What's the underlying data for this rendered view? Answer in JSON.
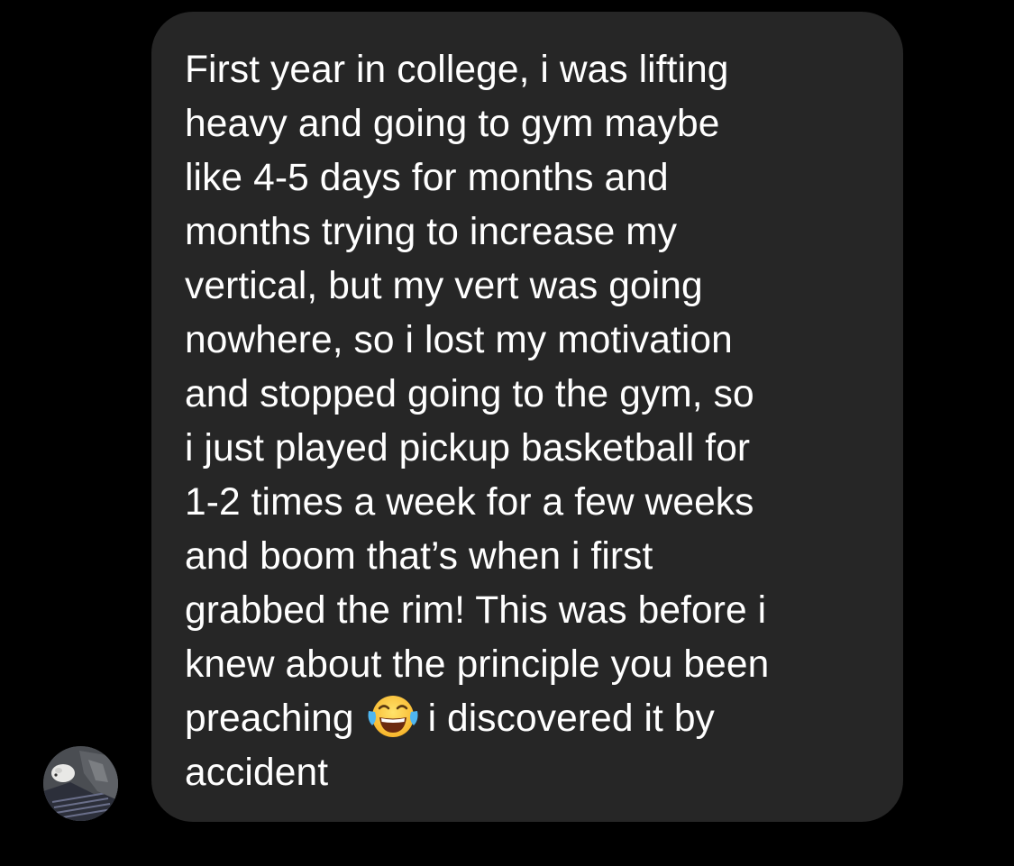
{
  "conversation": {
    "message": {
      "lines": [
        "First year in college, i was lifting",
        "heavy and going to gym maybe",
        "like 4-5 days for months and",
        "months trying to increase my",
        "vertical, but my vert was going",
        "nowhere, so i lost my motivation",
        "and stopped going to the gym, so",
        "i just played pickup basketball for",
        "1-2 times a week for a few weeks",
        "and boom that’s when i first",
        "grabbed the rim! This was before i",
        "knew about the principle you been"
      ],
      "line_13_before_emoji": "preaching",
      "emoji": "face-with-tears-of-joy",
      "line_13_after_emoji": "i discovered it by",
      "line_14": "accident"
    },
    "sender": {
      "avatar": "profile-photo"
    },
    "colors": {
      "background": "#000000",
      "bubble": "#262626",
      "text": "#ffffff"
    }
  }
}
